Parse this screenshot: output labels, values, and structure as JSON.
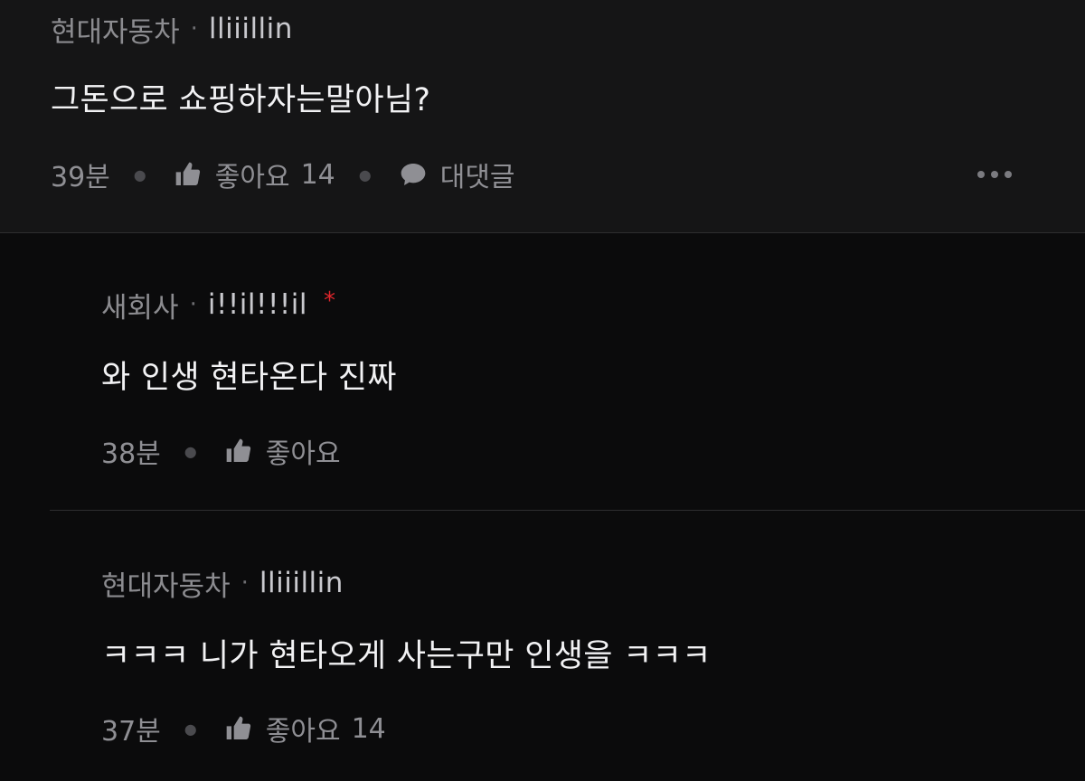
{
  "comments": [
    {
      "company": "현대자동차",
      "separator": "·",
      "nickname": "lliiillin",
      "text": "그돈으로 쇼핑하자는말아님?",
      "time": "39분",
      "like_label": "좋아요",
      "like_count": "14",
      "reply_label": "대댓글"
    },
    {
      "company": "새회사",
      "separator": "·",
      "nickname": "i!!il!!!il",
      "new_mark": "*",
      "text": "와 인생 현타온다 진짜",
      "time": "38분",
      "like_label": "좋아요"
    },
    {
      "company": "현대자동차",
      "separator": "·",
      "nickname": "lliiillin",
      "text": "ㅋㅋㅋ 니가 현타오게 사는구만 인생을 ㅋㅋㅋ",
      "time": "37분",
      "like_label": "좋아요",
      "like_count": "14"
    }
  ],
  "icons": {
    "like": "thumbs-up-icon",
    "reply": "speech-bubble-icon",
    "more": "more-dots-icon"
  },
  "colors": {
    "background": "#0b0b0c",
    "top_comment_bg": "#151516",
    "new_mark": "#e0262c",
    "text": "#f2f2f4",
    "muted": "#8c8c90"
  }
}
